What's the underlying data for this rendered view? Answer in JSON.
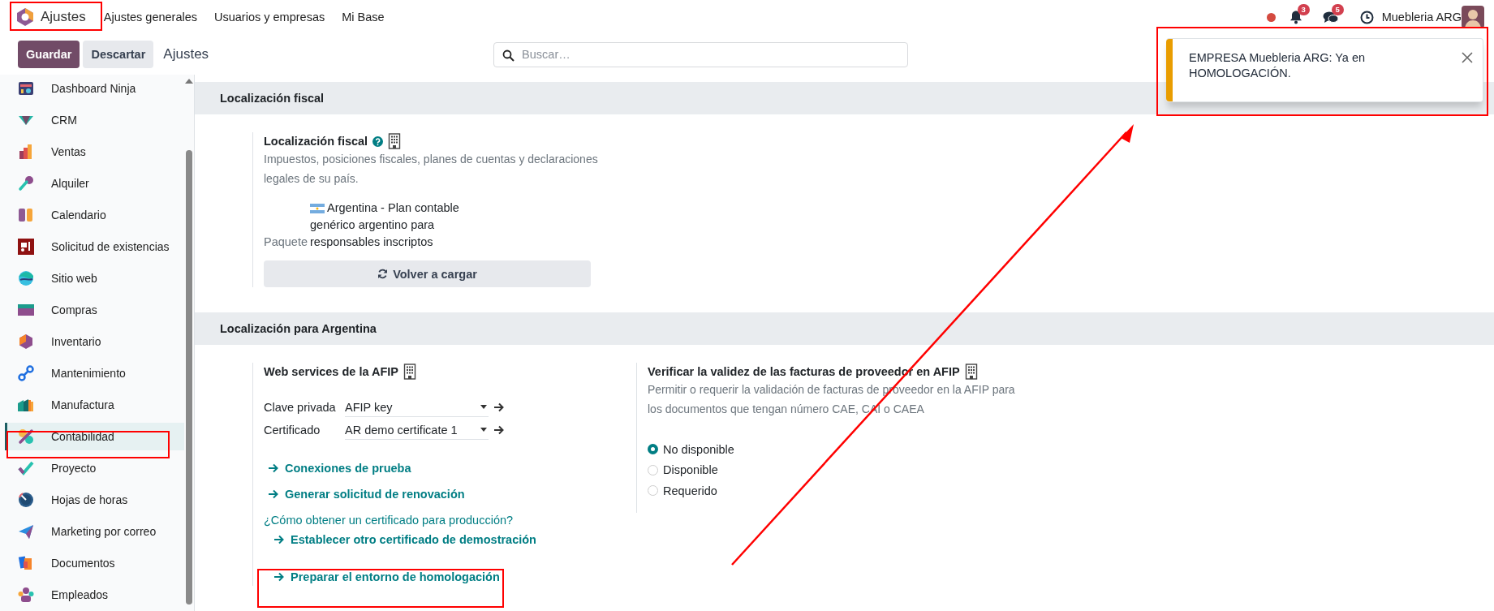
{
  "navbar": {
    "app_title": "Ajustes",
    "menu": [
      "Ajustes generales",
      "Usuarios y empresas",
      "Mi Base"
    ],
    "notifications": "3",
    "messages": "5",
    "company": "Muebleria ARG"
  },
  "control_bar": {
    "buttons": [
      {
        "label": "Guardar",
        "kind": "primary"
      },
      {
        "label": "Descartar",
        "kind": "secondary"
      }
    ],
    "breadcrumb": "Ajustes",
    "search": {
      "placeholder": "Buscar…"
    }
  },
  "sidebar": {
    "items": [
      {
        "label": "Dashboard Ninja",
        "selected": false
      },
      {
        "label": "CRM",
        "selected": false
      },
      {
        "label": "Ventas",
        "selected": false
      },
      {
        "label": "Alquiler",
        "selected": false
      },
      {
        "label": "Calendario",
        "selected": false
      },
      {
        "label": "Solicitud de existencias",
        "selected": false
      },
      {
        "label": "Sitio web",
        "selected": false
      },
      {
        "label": "Compras",
        "selected": false
      },
      {
        "label": "Inventario",
        "selected": false
      },
      {
        "label": "Mantenimiento",
        "selected": false
      },
      {
        "label": "Manufactura",
        "selected": false
      },
      {
        "label": "Contabilidad",
        "selected": true
      },
      {
        "label": "Proyecto",
        "selected": false
      },
      {
        "label": "Hojas de horas",
        "selected": false
      },
      {
        "label": "Marketing por correo",
        "selected": false
      },
      {
        "label": "Documentos",
        "selected": false
      },
      {
        "label": "Empleados",
        "selected": false
      }
    ]
  },
  "sections": [
    {
      "title": "Localización fiscal",
      "settings": [
        {
          "title": "Localización fiscal",
          "description": "Impuestos, posiciones fiscales, planes de cuentas y declaraciones legales de su país.",
          "fields": [
            {
              "label": "Paquete",
              "value": "Argentina - Plan contable genérico argentino para responsables inscriptos",
              "kind": "package"
            }
          ],
          "button": "Volver a cargar"
        }
      ]
    },
    {
      "title": "Localización para Argentina",
      "settings": [
        {
          "title": "Web services de la AFIP",
          "fields": [
            {
              "label": "Clave privada",
              "value": "AFIP key",
              "kind": "select"
            },
            {
              "label": "Certificado",
              "value": "AR demo certificate 1",
              "kind": "select"
            }
          ],
          "links": [
            {
              "label": "Conexiones de prueba",
              "kind": "arrow"
            },
            {
              "label": "Generar solicitud de renovación",
              "kind": "arrow"
            },
            {
              "label": "¿Cómo obtener un certificado para producción?",
              "kind": "plain"
            },
            {
              "label": "Establecer otro certificado de demostración",
              "kind": "indented"
            },
            {
              "label": "Preparar el entorno de homologación",
              "kind": "indented"
            }
          ]
        },
        {
          "title": "Verificar la validez de las facturas de proveedor en AFIP",
          "description": "Permitir o requerir la validación de facturas de proveedor en la AFIP para los documentos que tengan número CAE, CAI o CAEA",
          "options": [
            {
              "label": "No disponible",
              "selected": true
            },
            {
              "label": "Disponible",
              "selected": false
            },
            {
              "label": "Requerido",
              "selected": false
            }
          ]
        }
      ]
    }
  ],
  "toast": {
    "message": "EMPRESA Muebleria ARG: Ya en HOMOLOGACIÓN."
  }
}
